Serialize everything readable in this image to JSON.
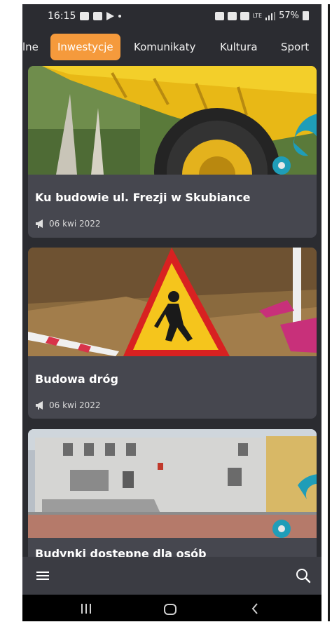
{
  "status": {
    "time": "16:15",
    "battery": "57%",
    "signal_text": "LTE"
  },
  "tabs": [
    {
      "label": "lne"
    },
    {
      "label": "Inwestycje",
      "active": true
    },
    {
      "label": "Komunikaty"
    },
    {
      "label": "Kultura"
    },
    {
      "label": "Sport"
    }
  ],
  "articles": [
    {
      "title": "Ku budowie ul. Frezji w Skubiance",
      "date": "06 kwi 2022",
      "image": "dump-truck-photo"
    },
    {
      "title": "Budowa dróg",
      "date": "06 kwi 2022",
      "image": "road-works-sign-photo"
    },
    {
      "title": "Budynki dostepne dla osób",
      "image": "building-photo"
    }
  ],
  "bottom_bar": {
    "menu_icon": "hamburger-icon",
    "search_icon": "search-icon"
  },
  "nav": {
    "recents_icon": "recents-icon",
    "home_icon": "home-icon",
    "back_icon": "back-icon"
  },
  "colors": {
    "accent": "#f59a3c",
    "background": "#2b2c31",
    "card": "#46474f"
  }
}
